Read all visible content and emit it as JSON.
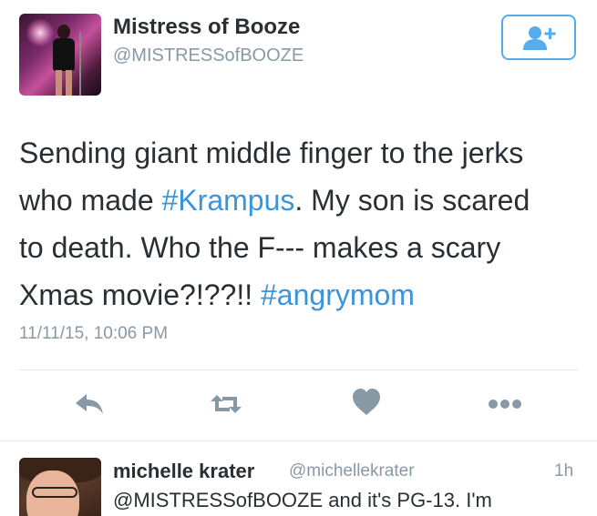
{
  "tweet": {
    "author": {
      "display_name": "Mistress of Booze",
      "screen_name": "@MISTRESSofBOOZE"
    },
    "text_lines": [
      [
        {
          "text": "Sending giant middle finger to the jerks",
          "hashtag": false
        }
      ],
      [
        {
          "text": "who made ",
          "hashtag": false
        },
        {
          "text": "#Krampus",
          "hashtag": true
        },
        {
          "text": ". My son is scared",
          "hashtag": false
        }
      ],
      [
        {
          "text": "to death. Who the F--- makes a scary",
          "hashtag": false
        }
      ],
      [
        {
          "text": "Xmas movie?!??!! ",
          "hashtag": false
        },
        {
          "text": "#angrymom",
          "hashtag": true
        }
      ]
    ],
    "timestamp": "11/11/15, 10:06 PM",
    "actions": {
      "reply_icon": "reply-arrow-icon",
      "retweet_icon": "retweet-icon",
      "like_icon": "heart-icon",
      "more_icon": "more-dots-icon"
    },
    "follow_icon": "add-user-icon"
  },
  "reply": {
    "display_name": "michelle krater",
    "screen_name": "@michellekrater",
    "time": "1h",
    "text": "@MISTRESSofBOOZE and it's PG-13. I'm"
  },
  "colors": {
    "accent": "#55acee",
    "hashtag": "#3b94d9",
    "muted": "#8899a6",
    "icon": "#8899a6",
    "text": "#292f33"
  }
}
